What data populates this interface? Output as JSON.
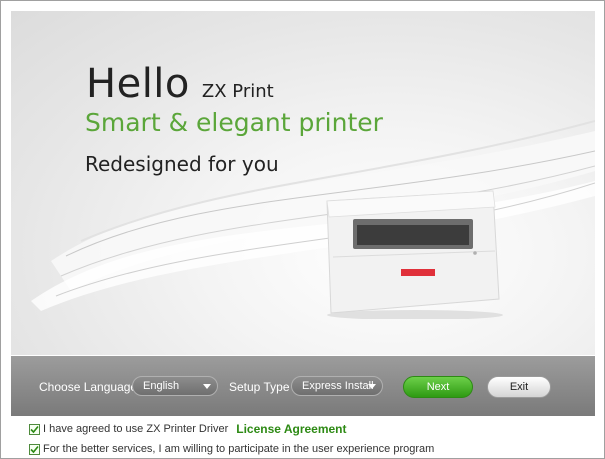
{
  "hero": {
    "hello": "Hello",
    "brand": "ZX Print",
    "tagline": "Smart & elegant printer",
    "subline": "Redesigned for you"
  },
  "controls": {
    "language_label": "Choose Language",
    "language_value": "English",
    "setup_label": "Setup Type",
    "setup_value": "Express Install",
    "next_label": "Next",
    "exit_label": "Exit"
  },
  "agreements": {
    "license_text": "I have agreed to use ZX Printer Driver",
    "license_link": "License Agreement",
    "license_checked": true,
    "experience_text": "For the better services, I am willing to participate in the user experience program",
    "experience_checked": true
  },
  "colors": {
    "accent_green": "#5ba63a",
    "next_button": "#3fb21c",
    "bar_gray": "#8a8a8a",
    "printer_red_panel": "#e0303a"
  },
  "icons": {
    "checkbox_checked": "check-icon",
    "dropdown": "chevron-down-icon"
  }
}
